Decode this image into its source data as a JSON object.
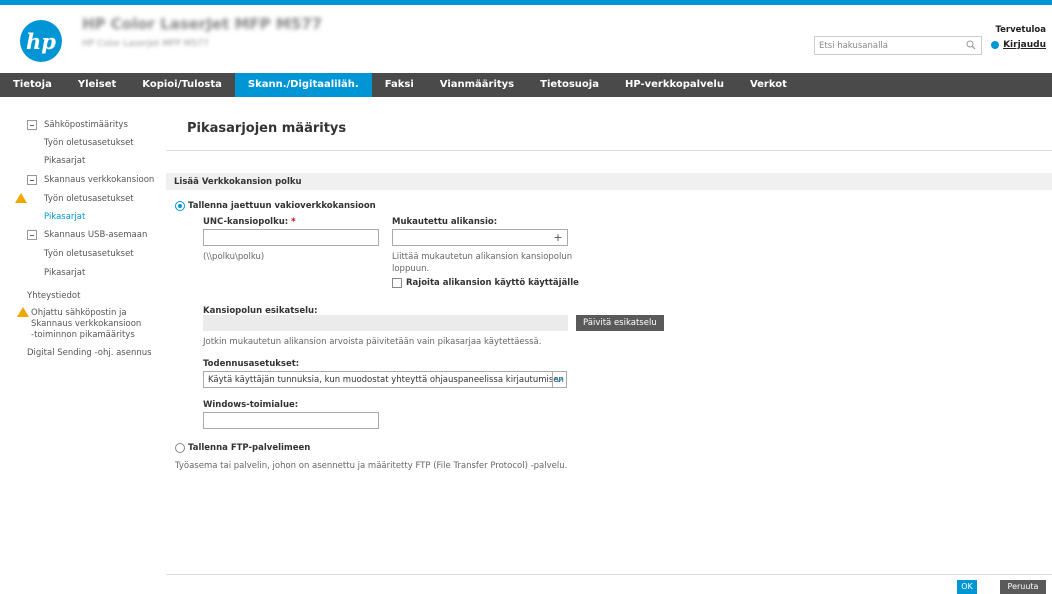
{
  "header": {
    "device_title": "HP Color LaserJet MFP M577",
    "device_subtitle": "HP Color LaserJet MFP M577",
    "search_placeholder": "Etsi hakusanalla",
    "welcome": "Tervetuloa",
    "login": "Kirjaudu"
  },
  "nav": {
    "tabs": [
      {
        "label": "Tietoja"
      },
      {
        "label": "Yleiset"
      },
      {
        "label": "Kopioi/Tulosta"
      },
      {
        "label": "Skann./Digitaaliläh."
      },
      {
        "label": "Faksi"
      },
      {
        "label": "Vianmääritys"
      },
      {
        "label": "Tietosuoja"
      },
      {
        "label": "HP-verkkopalvelu"
      },
      {
        "label": "Verkot"
      }
    ],
    "active_index": 3
  },
  "sidebar": {
    "items": [
      {
        "label": "Sähköpostimääritys"
      },
      {
        "label": "Työn oletusasetukset"
      },
      {
        "label": "Pikasarjat"
      },
      {
        "label": "Skannaus verkkokansioon"
      },
      {
        "label": "Työn oletusasetukset"
      },
      {
        "label": "Pikasarjat"
      },
      {
        "label": "Skannaus USB-asemaan"
      },
      {
        "label": "Työn oletusasetukset"
      },
      {
        "label": "Pikasarjat"
      },
      {
        "label": "Yhteystiedot"
      },
      {
        "label": "Ohjattu sähköpostin ja"
      },
      {
        "label": "Skannaus verkkokansioon"
      },
      {
        "label": "-toiminnon pikamääritys"
      },
      {
        "label": "Digital Sending -ohj. asennus"
      }
    ]
  },
  "main": {
    "title": "Pikasarjojen määritys",
    "section_title": "Lisää Verkkokansion polku",
    "radio_shared": "Tallenna jaettuun vakioverkkokansioon",
    "unc_label": "UNC-kansiopolku:",
    "required_mark": "*",
    "unc_hint": "(\\\\polku\\polku)",
    "custom_label": "Mukautettu alikansio:",
    "custom_hint_1": "Liittää mukautetun alikansion kansiopolun",
    "custom_hint_2": "loppuun.",
    "restrict_label": "Rajoita alikansion käyttö käyttäjälle",
    "preview_label": "Kansiopolun esikatselu:",
    "update_preview": "Päivitä esikatselu",
    "preview_note": "Jotkin mukautetun alikansion arvoista päivitetään vain pikasarjaa käytettäessä.",
    "auth_label": "Todennusasetukset:",
    "auth_value": "Käytä käyttäjän tunnuksia, kun muodostat yhteyttä ohjauspaneelissa kirjautumisen",
    "domain_label": "Windows-toimialue:",
    "radio_ftp": "Tallenna FTP-palvelimeen",
    "ftp_desc": "Työasema tai palvelin, johon on asennettu ja määritetty FTP (File Transfer Protocol) -palvelu."
  },
  "footer": {
    "ok": "OK",
    "cancel": "Peruuta"
  },
  "colors": {
    "accent": "#0096d6",
    "nav_bg": "#4a4a4a",
    "warning": "#f0a800"
  }
}
